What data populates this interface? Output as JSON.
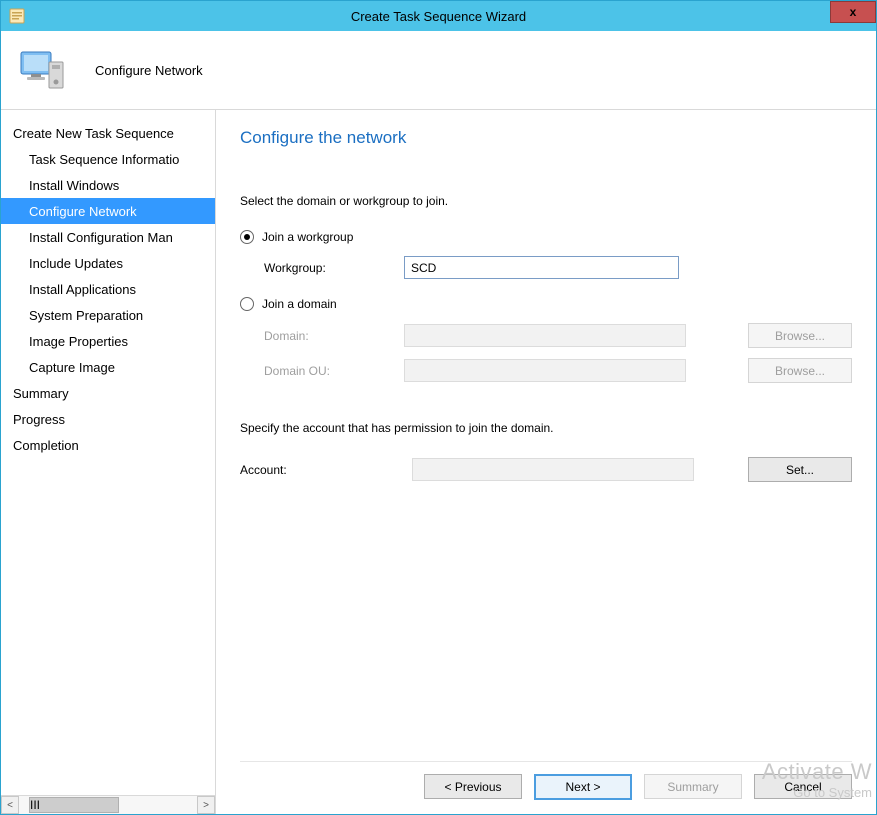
{
  "titlebar": {
    "title": "Create Task Sequence Wizard",
    "close_label": "x"
  },
  "banner": {
    "title": "Configure Network"
  },
  "sidebar": {
    "items": [
      {
        "label": "Create New Task Sequence",
        "level": 0
      },
      {
        "label": "Task Sequence Informatio",
        "level": 1
      },
      {
        "label": "Install Windows",
        "level": 1
      },
      {
        "label": "Configure Network",
        "level": 1,
        "active": true
      },
      {
        "label": "Install Configuration Man",
        "level": 1
      },
      {
        "label": "Include Updates",
        "level": 1
      },
      {
        "label": "Install Applications",
        "level": 1
      },
      {
        "label": "System Preparation",
        "level": 1
      },
      {
        "label": "Image Properties",
        "level": 1
      },
      {
        "label": "Capture Image",
        "level": 1
      },
      {
        "label": "Summary",
        "level": 0
      },
      {
        "label": "Progress",
        "level": 0
      },
      {
        "label": "Completion",
        "level": 0
      }
    ],
    "scroll_thumb": "III"
  },
  "main": {
    "page_title": "Configure the network",
    "instruction": "Select the domain or workgroup to join.",
    "join_workgroup_label": "Join a workgroup",
    "workgroup_label": "Workgroup:",
    "workgroup_value": "SCD",
    "join_domain_label": "Join a domain",
    "domain_label": "Domain:",
    "domain_value": "",
    "domain_ou_label": "Domain OU:",
    "domain_ou_value": "",
    "browse_label": "Browse...",
    "account_instruction": "Specify the account that has permission to join the domain.",
    "account_label": "Account:",
    "account_value": "",
    "set_label": "Set..."
  },
  "footer": {
    "previous": "< Previous",
    "next": "Next >",
    "summary": "Summary",
    "cancel": "Cancel"
  },
  "watermark": {
    "line1": "Activate W",
    "line2": "Go to System"
  }
}
